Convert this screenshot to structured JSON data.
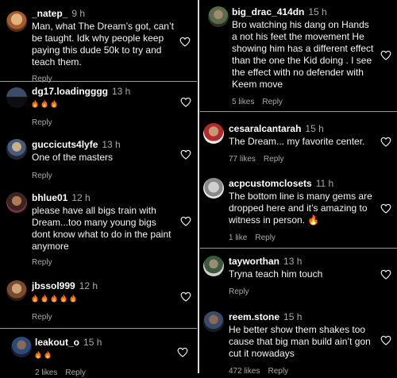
{
  "ui": {
    "reply_label": "Reply"
  },
  "left_comments": [
    {
      "username": "_natep_",
      "time": "9 h",
      "text": "Man, what The Dream’s got, can’t be taught. Idk why people keep paying this dude 50k to try and teach them.",
      "likes": ""
    },
    {
      "username": "dg17.loadingggg",
      "time": "13 h",
      "text": "🔥🔥🔥",
      "likes": ""
    },
    {
      "username": "guccicuts4lyfe",
      "time": "13 h",
      "text": "One of the masters",
      "likes": ""
    },
    {
      "username": "bhlue01",
      "time": "12 h",
      "text": "please have all bigs train with Dream...too many young bigs dont know what to do in the paint anymore",
      "likes": ""
    },
    {
      "username": "jbssol999",
      "time": "12 h",
      "text": "🔥🔥🔥🔥🔥",
      "likes": ""
    },
    {
      "username": "leakout_o",
      "time": "15 h",
      "text": "🔥🔥",
      "likes": "2 likes"
    }
  ],
  "right_comments": [
    {
      "username": "big_drac_414dn",
      "time": "15 h",
      "text": "Bro watching his dang on Hands a not his feet the movement He showing him has a different effect than the one the Kid doing . I see the effect with no defender with Keem move",
      "likes": "5 likes"
    },
    {
      "username": "cesaralcantarah",
      "time": "15 h",
      "text": "The Dream... my favorite center.",
      "likes": "77 likes"
    },
    {
      "username": "acpcustomclosets",
      "time": "11 h",
      "text": "The bottom line is many gems are dropped here and it’s amazing to witness in person. 🔥",
      "likes": "1 like"
    },
    {
      "username": "tayworthan",
      "time": "13 h",
      "text": "Tryna teach him touch",
      "likes": ""
    },
    {
      "username": "reem.stone",
      "time": "15 h",
      "text": "He better show them shakes too cause that big man build ain’t gon cut it nowadays",
      "likes": "472 likes"
    }
  ]
}
